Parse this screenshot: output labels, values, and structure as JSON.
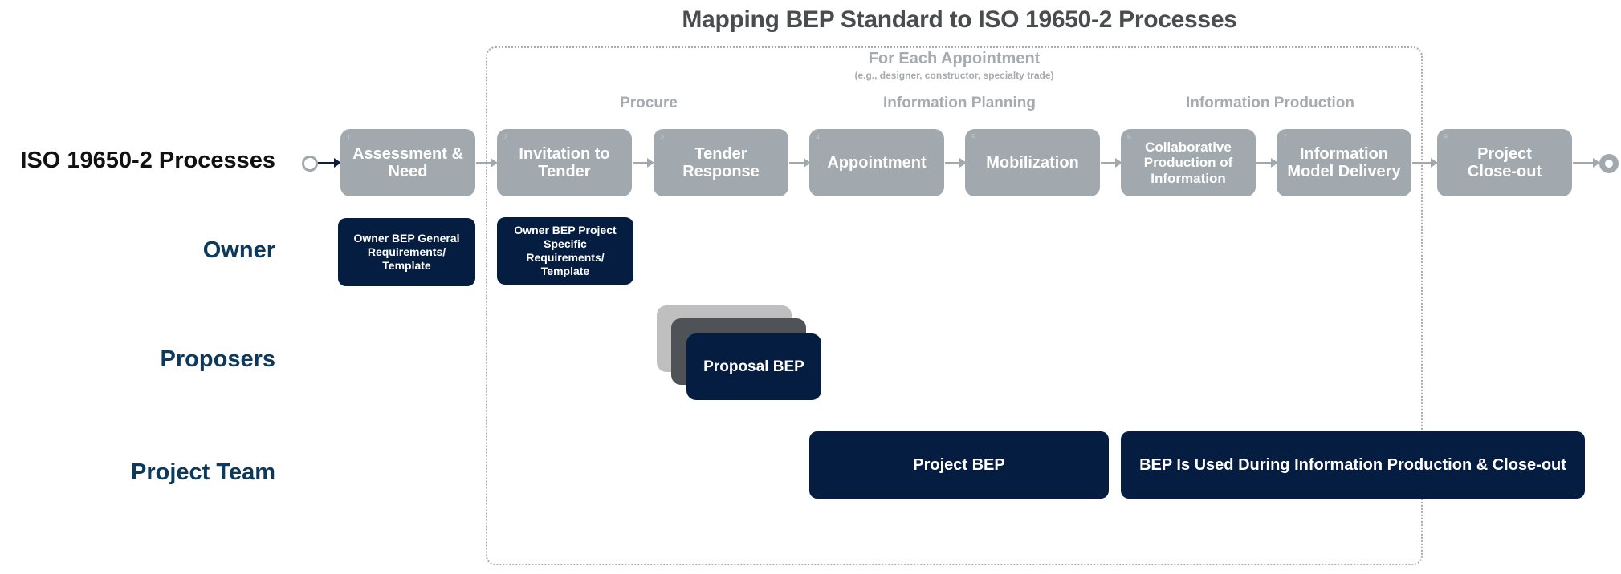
{
  "title": "Mapping BEP Standard to ISO 19650-2 Processes",
  "container": {
    "title": "For Each Appointment",
    "subtitle": "(e.g., designer, constructor, specialty trade)"
  },
  "stages": [
    {
      "label": "Procure"
    },
    {
      "label": "Information Planning"
    },
    {
      "label": "Information Production"
    }
  ],
  "lanes": {
    "iso": "ISO 19650-2 Processes",
    "owner": "Owner",
    "proposers": "Proposers",
    "project_team": "Project Team"
  },
  "processes": [
    {
      "num": "1",
      "label": "Assessment & Need"
    },
    {
      "num": "2",
      "label": "Invitation to Tender"
    },
    {
      "num": "3",
      "label": "Tender Response"
    },
    {
      "num": "4",
      "label": "Appointment"
    },
    {
      "num": "5",
      "label": "Mobilization"
    },
    {
      "num": "6",
      "label": "Collaborative Production of Information"
    },
    {
      "num": "7",
      "label": "Information Model Delivery"
    },
    {
      "num": "8",
      "label": "Project Close-out"
    }
  ],
  "owner_items": [
    {
      "label": "Owner BEP General Requirements/ Template"
    },
    {
      "label": "Owner BEP Project Specific Requirements/ Template"
    }
  ],
  "proposer_items": [
    {
      "label": "Proposal BEP"
    }
  ],
  "team_items": [
    {
      "label": "Project BEP"
    },
    {
      "label": "BEP Is Used During Information Production & Close-out"
    }
  ],
  "colors": {
    "process_fill": "#a2a9ae",
    "deliverable_fill": "#061d42",
    "role_label": "#0d3a5c",
    "title": "#4a4d50",
    "muted": "#a6abaf"
  }
}
